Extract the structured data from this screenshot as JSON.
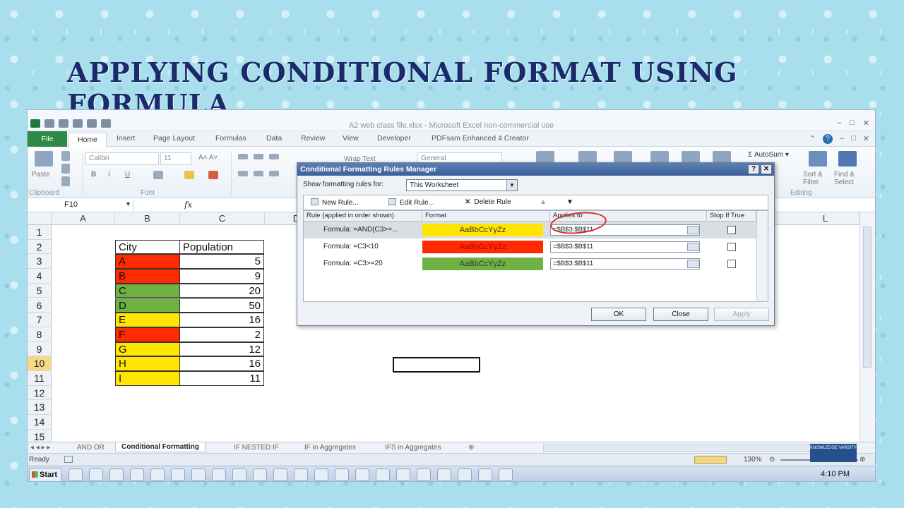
{
  "slide_title": "APPLYING CONDITIONAL FORMAT USING FORMULA",
  "window": {
    "title": "A2 web class file.xlsx - Microsoft Excel non-commercial use",
    "min": "–",
    "max": "□",
    "close": "✕"
  },
  "ribbon_tabs": {
    "file": "File",
    "items": [
      "Home",
      "Insert",
      "Page Layout",
      "Formulas",
      "Data",
      "Review",
      "View",
      "Developer",
      "PDFsam Enhanced 4 Creator"
    ]
  },
  "ribbon": {
    "paste": "Paste",
    "clipboard_group": "Clipboard",
    "font_name": "Calibri",
    "font_size": "11",
    "bold": "B",
    "italic": "I",
    "underline": "U",
    "font_group": "Font",
    "wrap_text": "Wrap Text",
    "number_format": "General",
    "autosum": "AutoSum",
    "sort_filter": "Sort & Filter",
    "find_select": "Find & Select",
    "editing_group": "Editing",
    "sigma": "Σ"
  },
  "formula_bar": {
    "name_box": "F10",
    "fx": "fx"
  },
  "columns": [
    "A",
    "B",
    "C",
    "D",
    "L"
  ],
  "rows": [
    "1",
    "2",
    "3",
    "4",
    "5",
    "6",
    "7",
    "8",
    "9",
    "10",
    "11",
    "12",
    "13",
    "14",
    "15"
  ],
  "table": {
    "headers": [
      "City",
      "Population"
    ],
    "rows": [
      {
        "city": "A",
        "population": "5",
        "color": "#ff2a00"
      },
      {
        "city": "B",
        "population": "9",
        "color": "#ff2a00"
      },
      {
        "city": "C",
        "population": "20",
        "color": "#6fb244"
      },
      {
        "city": "D",
        "population": "50",
        "color": "#6fb244"
      },
      {
        "city": "E",
        "population": "16",
        "color": "#ffe500"
      },
      {
        "city": "F",
        "population": "2",
        "color": "#ff2a00"
      },
      {
        "city": "G",
        "population": "12",
        "color": "#ffe500"
      },
      {
        "city": "H",
        "population": "16",
        "color": "#ffe500"
      },
      {
        "city": "I",
        "population": "11",
        "color": "#ffe500"
      }
    ]
  },
  "sheet_tabs": [
    "AND OR",
    "Conditional Formatting",
    "IF NESTED IF",
    "IF in Aggregates",
    "IFS in Aggregates"
  ],
  "status": {
    "ready": "Ready",
    "zoom": "130%"
  },
  "brand_logo": "KNOWLEDGE VARSITY",
  "taskbar": {
    "start": "Start",
    "clock": "4:10 PM"
  },
  "dialog": {
    "title": "Conditional Formatting Rules Manager",
    "help": "?",
    "close": "✕",
    "show_label": "Show formatting rules for:",
    "show_value": "This Worksheet",
    "new_rule": "New Rule...",
    "edit_rule": "Edit Rule...",
    "delete_rule": "Delete Rule",
    "col_rule": "Rule (applied in order shown)",
    "col_format": "Format",
    "col_applies": "Applies to",
    "col_stop": "Stop If True",
    "rules": [
      {
        "rule": "Formula: =AND(C3>=...",
        "preview": "AaBbCcYyZz",
        "color": "#ffe500",
        "applies_to": "=$B$3:$B$11"
      },
      {
        "rule": "Formula: =C3<10",
        "preview": "AaBbCcYyZz",
        "color": "#ff2a00",
        "applies_to": "=$B$3:$B$11"
      },
      {
        "rule": "Formula: =C3>=20",
        "preview": "AaBbCcYyZz",
        "color": "#6fb244",
        "applies_to": "=$B$3:$B$11"
      }
    ],
    "ok": "OK",
    "close_btn": "Close",
    "apply": "Apply"
  }
}
